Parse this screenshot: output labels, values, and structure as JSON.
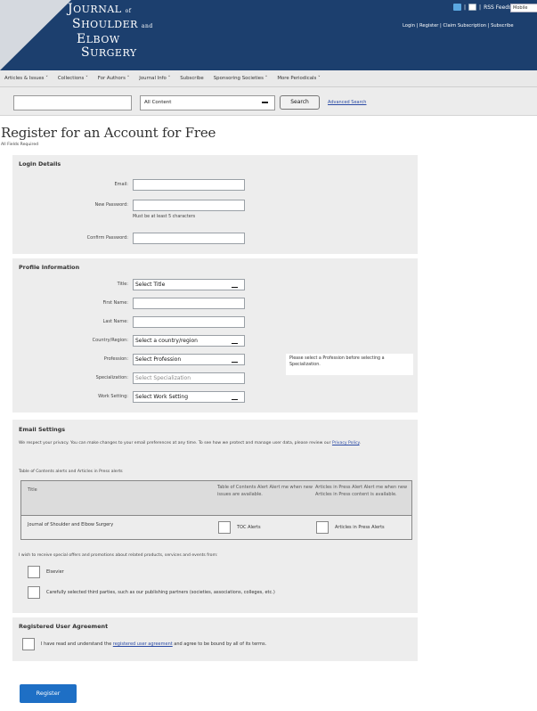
{
  "header": {
    "logo_lines": [
      "J",
      "OURNAL",
      "of",
      "S",
      "HOULDER",
      "and",
      "E",
      "LBOW",
      "S",
      "URGERY"
    ],
    "rss_label": "RSS Feeds",
    "mobile_label": "Mobile",
    "links": "Login | Register | Claim Subscription | Subscribe"
  },
  "nav": {
    "items": [
      "Articles & Issues ˅",
      "Collections ˅",
      "For Authors ˅",
      "Journal Info ˅",
      "Subscribe",
      "Sponsoring Societies ˅",
      "More Periodicals ˅"
    ]
  },
  "search": {
    "input_value": "",
    "scope_selected": "All Content",
    "button_label": "Search",
    "advanced_link": "Advanced Search"
  },
  "page": {
    "title": "Register for an Account for Free",
    "required_note": "All Fields Required"
  },
  "login": {
    "heading": "Login Details",
    "email_label": "Email:",
    "password_label": "New Password:",
    "password_hint": "Must be at least 5 characters",
    "confirm_label": "Confirm Password:"
  },
  "profile": {
    "heading": "Profile Information",
    "title_label": "Title:",
    "title_value": "Select Title",
    "first_label": "First Name:",
    "last_label": "Last Name:",
    "country_label": "Country/Region:",
    "country_value": "Select a country/region",
    "profession_label": "Profession:",
    "profession_value": "Select Profession",
    "profession_note": "Please select a Profession before selecting a Specialization.",
    "specialization_label": "Specialization:",
    "specialization_value": "Select Specialization",
    "work_label": "Work Setting:",
    "work_value": "Select Work Setting"
  },
  "email_settings": {
    "heading": "Email Settings",
    "privacy_text": "We respect your privacy. You can make changes to your email preferences at any time. To see how we protect and manage user data, please review our",
    "privacy_link": "Privacy Policy",
    "privacy_end": ".",
    "toc_intro": "Table of Contents alerts and Articles in Press alerts",
    "table": {
      "col_title": "Title",
      "col_toc": "Table of Contents Alert Alert me when new issues are available.",
      "col_aip": "Articles in Press Alert Alert me when new Articles in Press content is available.",
      "journal": "Journal of Shoulder and Elbow Surgery",
      "toc_check_label": "TOC Alerts",
      "aip_check_label": "Articles in Press Alerts"
    },
    "promo_text": "I wish to receive special offers and promotions about related products, services and events from:",
    "option_elsevier": "Elsevier",
    "option_third_party": "Carefully selected third parties, such as our publishing partners (societies, associations, colleges, etc.)"
  },
  "agreement": {
    "heading": "Registered User Agreement",
    "text_before": "I have read and understand the",
    "link": "registered user agreement",
    "text_after": "and agree to be bound by all of its terms."
  },
  "submit": {
    "label": "Register"
  },
  "colors": {
    "header_bg": "#1c3f6e",
    "accent_button": "#1e6fc5",
    "section_bg": "#ededed",
    "link": "#2b4ba5"
  },
  "icons": [
    "twitter-icon",
    "facebook-icon",
    "rss-icon"
  ]
}
